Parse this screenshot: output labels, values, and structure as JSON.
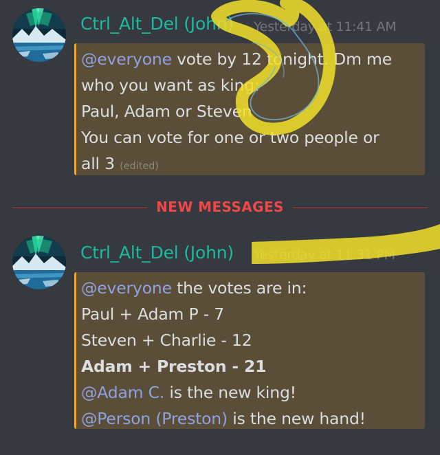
{
  "colors": {
    "background": "#36393f",
    "username": "#1abc9c",
    "timestamp": "#72767d",
    "mention": "#8ea1e1",
    "mention_highlight_bg": "#5b4e38",
    "mention_bar": "#faa61a",
    "new_messages": "#f04747",
    "scribble": "#f1e12a"
  },
  "messages": [
    {
      "author": "Ctrl_Alt_Del (John)",
      "timestamp": "Yesterday at 11:41 AM",
      "avatar_icon": "aurora-landscape-avatar",
      "lines": [
        {
          "mention": "@everyone",
          "text": " vote by 12 tonight. Dm me"
        },
        {
          "text": "who you want as king:"
        },
        {
          "text": "Paul, Adam or Steven"
        },
        {
          "text": "You can vote for one or two people or"
        },
        {
          "text": "all 3",
          "edited": "(edited)"
        }
      ]
    },
    {
      "author": "Ctrl_Alt_Del (John)",
      "timestamp": "Yesterday at 11:31 PM",
      "avatar_icon": "aurora-landscape-avatar",
      "lines": [
        {
          "mention": "@everyone",
          "text": " the votes are in:"
        },
        {
          "text": "Paul + Adam P - 7"
        },
        {
          "text": "Steven + Charlie - 12"
        },
        {
          "text": "Adam + Preston - 21"
        },
        {
          "mention": "@Adam C.",
          "text": " is the new king!"
        },
        {
          "mention": "@Person (Preston)",
          "text": " is the new hand!"
        }
      ]
    }
  ],
  "divider": {
    "label": "NEW MESSAGES"
  }
}
